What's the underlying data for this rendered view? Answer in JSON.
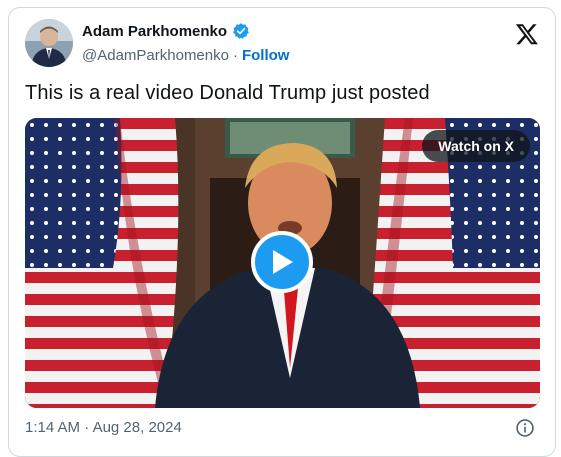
{
  "author": {
    "display_name": "Adam Parkhomenko",
    "handle": "@AdamParkhomenko",
    "separator": "·",
    "follow_label": "Follow"
  },
  "tweet": {
    "text": "This is a real video Donald Trump just posted",
    "time": "1:14 AM",
    "date": "Aug 28, 2024",
    "meta_separator": "·"
  },
  "video": {
    "watch_label": "Watch on X"
  },
  "icons": {
    "verified": "verified-badge-icon",
    "brand": "x-logo-icon",
    "play": "play-icon",
    "info": "info-icon"
  },
  "colors": {
    "accent": "#1d9bf0",
    "follow": "#006fd6",
    "text": "#0f1419",
    "muted": "#536471",
    "border": "#cfd9de"
  }
}
